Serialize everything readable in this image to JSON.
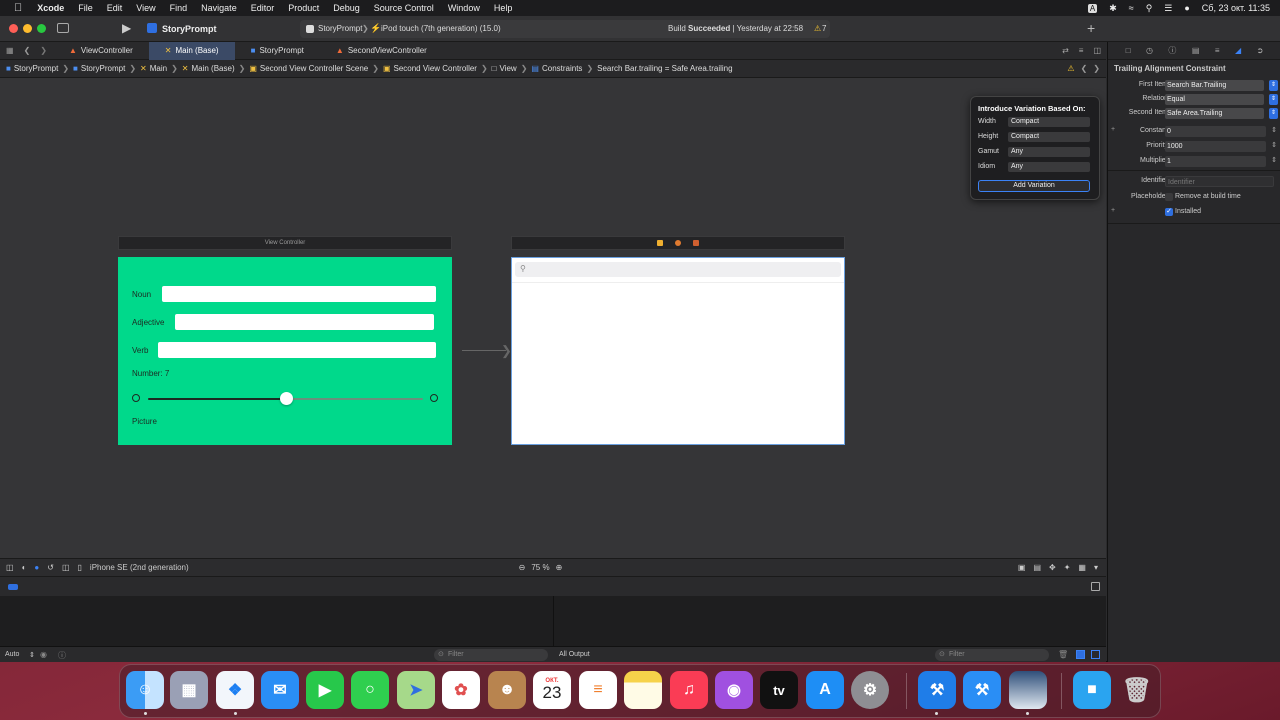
{
  "menubar": {
    "apple": "",
    "app": "Xcode",
    "items": [
      "File",
      "Edit",
      "View",
      "Find",
      "Navigate",
      "Editor",
      "Product",
      "Debug",
      "Source Control",
      "Window",
      "Help"
    ],
    "input_badge": "A",
    "datetime": "Сб, 23 окт.  11:35"
  },
  "toolbar": {
    "scheme_title": "StoryPrompt",
    "scheme_target": "StoryPrompt",
    "device": "iPod touch (7th generation) (15.0)",
    "build_status_prefix": "Build ",
    "build_status_bold": "Succeeded",
    "build_status_suffix": " | Yesterday at 22:58",
    "warnings": "7"
  },
  "tabs": [
    {
      "label": "ViewController"
    },
    {
      "label": "Main (Base)"
    },
    {
      "label": "StoryPrompt"
    },
    {
      "label": "SecondViewController"
    }
  ],
  "jumpbar": [
    "StoryPrompt",
    "StoryPrompt",
    "Main",
    "Main (Base)",
    "Second View Controller Scene",
    "Second View Controller",
    "View",
    "Constraints",
    "Search Bar.trailing = Safe Area.trailing"
  ],
  "scene1": {
    "header": "View Controller",
    "noun": "Noun",
    "adjective": "Adjective",
    "verb": "Verb",
    "number": "Number: 7",
    "slider_fraction": 0.5,
    "picture": "Picture"
  },
  "scene2": {
    "header": ""
  },
  "popover": {
    "title": "Introduce Variation Based On:",
    "rows": [
      {
        "label": "Width",
        "value": "Compact"
      },
      {
        "label": "Height",
        "value": "Compact"
      },
      {
        "label": "Gamut",
        "value": "Any"
      },
      {
        "label": "Idiom",
        "value": "Any"
      }
    ],
    "button": "Add Variation"
  },
  "inspector": {
    "title": "Trailing Alignment Constraint",
    "first_item_label": "First Item",
    "first_item": "Search Bar.Trailing",
    "relation_label": "Relation",
    "relation": "Equal",
    "second_item_label": "Second Item",
    "second_item": "Safe Area.Trailing",
    "constant_label": "Constant",
    "constant": "0",
    "priority_label": "Priority",
    "priority": "1000",
    "multiplier_label": "Multiplier",
    "multiplier": "1",
    "identifier_label": "Identifier",
    "identifier_placeholder": "Identifier",
    "placeholder_label": "Placeholder",
    "remove_label": "Remove at build time",
    "installed_label": "Installed"
  },
  "canvasbar": {
    "device": "iPhone SE (2nd generation)",
    "zoom": "75 %"
  },
  "console": {
    "auto": "Auto",
    "filter_placeholder": "Filter",
    "output": "All Output",
    "filter2_placeholder": "Filter"
  },
  "dock": {
    "calendar_month": "ОКТ.",
    "calendar_day": "23",
    "tv": "tv"
  }
}
